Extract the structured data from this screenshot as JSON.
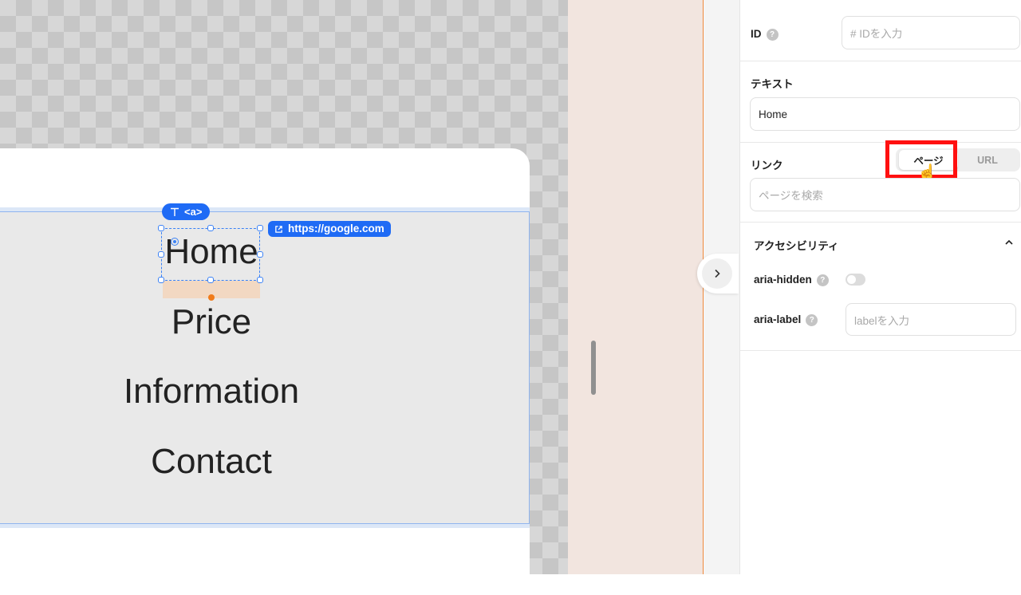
{
  "canvas": {
    "tag_label": "<a>",
    "link_url": "https://google.com",
    "nav_links": [
      "Home",
      "Price",
      "Information",
      "Contact"
    ]
  },
  "panel": {
    "id": {
      "label": "ID",
      "placeholder": "# IDを入力"
    },
    "text": {
      "label": "テキスト",
      "value": "Home"
    },
    "link": {
      "label": "リンク",
      "tab_page": "ページ",
      "tab_url": "URL",
      "search_placeholder": "ページを検索"
    },
    "accessibility": {
      "title": "アクセシビリティ",
      "aria_hidden_label": "aria-hidden",
      "aria_label_label": "aria-label",
      "aria_label_placeholder": "labelを入力"
    },
    "help_glyph": "?"
  },
  "colors": {
    "accent": "#1f6bf5",
    "highlight": "#ff1010",
    "drop": "#f07b1a"
  }
}
